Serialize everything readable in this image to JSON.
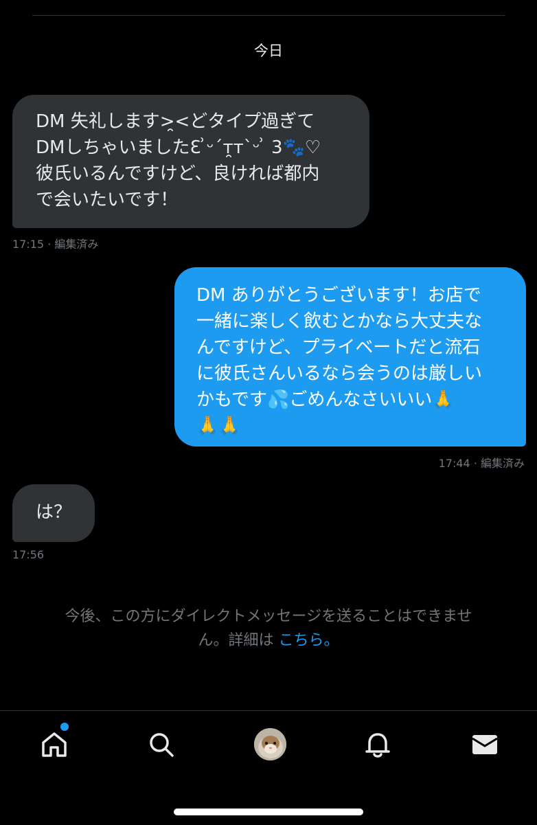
{
  "date_separator": "今日",
  "messages": [
    {
      "direction": "incoming",
      "lines": [
        "DM 失礼します>̯<どタイプ過ぎて",
        "DMしちゃいましたƐ ͗ᵕ´т̯т`ᵕ ͗ 3🐾♡",
        "彼氏いるんですけど、良ければ都内",
        "で会いたいです！"
      ],
      "meta": "17:15 · 編集済み"
    },
    {
      "direction": "outgoing",
      "lines": [
        "DM ありがとうございます！お店で",
        "一緒に楽しく飲むとかなら大丈夫な",
        "んですけど、プライベートだと流石",
        "に彼氏さんいるなら会うのは厳しい",
        "かもです💦ごめんなさいいい🙏",
        "🙏🙏"
      ],
      "meta": "17:44 · 編集済み"
    },
    {
      "direction": "incoming",
      "lines": [
        "は？"
      ],
      "meta": "17:56"
    }
  ],
  "notice": {
    "line1": "今後、この方にダイレクトメッセージを送ることはできませ",
    "line2_prefix": "ん。詳細は ",
    "link_text": "こちら。"
  },
  "tabbar": {
    "items": [
      {
        "icon": "home-icon",
        "badge": true
      },
      {
        "icon": "search-icon"
      },
      {
        "icon": "avatar"
      },
      {
        "icon": "bell-icon"
      },
      {
        "icon": "mail-icon"
      }
    ]
  },
  "colors": {
    "background": "#000000",
    "incoming_bubble": "#2f3336",
    "outgoing_bubble": "#1d9bf0",
    "meta_text": "#71767b",
    "link": "#1d9bf0"
  }
}
